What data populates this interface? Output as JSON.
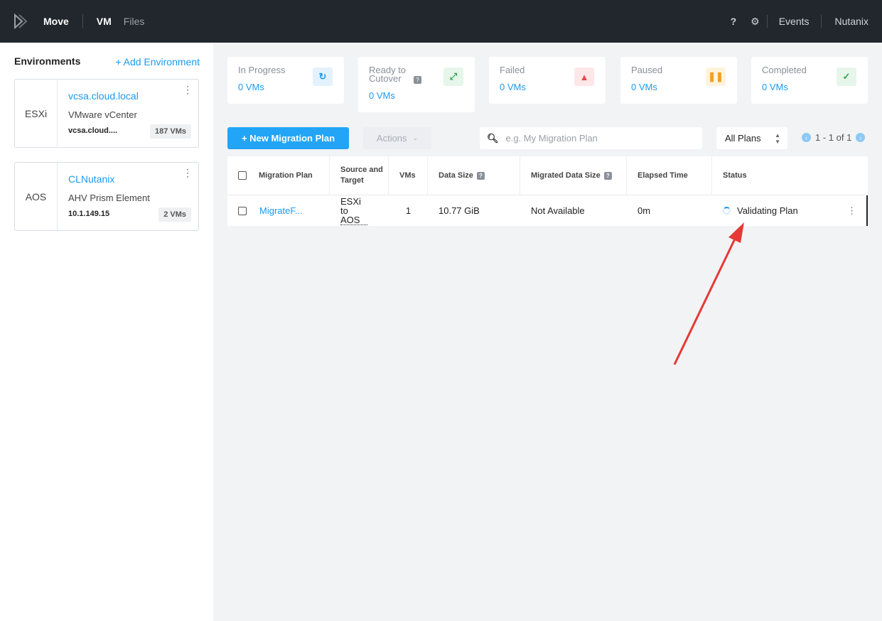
{
  "header": {
    "app": "Move",
    "tabs": [
      "VM",
      "Files"
    ],
    "help": "?",
    "events": "Events",
    "user": "Nutanix"
  },
  "sidebar": {
    "title": "Environments",
    "add": "+  Add Environment",
    "envs": [
      {
        "type": "ESXi",
        "name": "vcsa.cloud.local",
        "kind": "VMware vCenter",
        "host": "vcsa.cloud....",
        "count": "187 VMs"
      },
      {
        "type": "AOS",
        "name": "CLNutanix",
        "kind": "AHV Prism Element",
        "host": "10.1.149.15",
        "count": "2 VMs"
      }
    ]
  },
  "summary": [
    {
      "label": "In Progress",
      "value": "0 VMs",
      "icon": "refresh-icon",
      "color": "#1b9af0",
      "bg": "#e3f2fd",
      "glyph": "↻"
    },
    {
      "label": "Ready to Cutover",
      "value": "0 VMs",
      "icon": "cutover-icon",
      "color": "#2ea44f",
      "bg": "#e6f6ea",
      "glyph": "⤢"
    },
    {
      "label": "Failed",
      "value": "0 VMs",
      "icon": "warning-icon",
      "color": "#e5484d",
      "bg": "#fde7e8",
      "glyph": "▲"
    },
    {
      "label": "Paused",
      "value": "0 VMs",
      "icon": "pause-icon",
      "color": "#f0a020",
      "bg": "#fff3dc",
      "glyph": "❚❚"
    },
    {
      "label": "Completed",
      "value": "0 VMs",
      "icon": "check-icon",
      "color": "#2ea44f",
      "bg": "#e6f6ea",
      "glyph": "✓"
    }
  ],
  "toolbar": {
    "new_plan": "+  New Migration Plan",
    "actions": "Actions",
    "search_placeholder": "e.g. My Migration Plan",
    "filter": "All Plans",
    "pagination": "1 - 1 of 1"
  },
  "table": {
    "headers": [
      "Migration Plan",
      "Source and Target",
      "VMs",
      "Data Size",
      "Migrated Data Size",
      "Elapsed Time",
      "Status"
    ],
    "rows": [
      {
        "name": "MigrateF...",
        "source_target": "ESXi to AOS",
        "vms": "1",
        "data_size": "10.77 GiB",
        "migrated": "Not Available",
        "elapsed": "0m",
        "status": "Validating Plan"
      }
    ]
  }
}
